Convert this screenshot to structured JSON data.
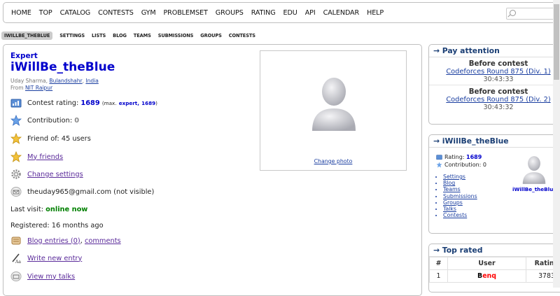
{
  "nav": {
    "items": [
      "HOME",
      "TOP",
      "CATALOG",
      "CONTESTS",
      "GYM",
      "PROBLEMSET",
      "GROUPS",
      "RATING",
      "EDU",
      "API",
      "CALENDAR",
      "HELP"
    ],
    "search_placeholder": ""
  },
  "subnav": {
    "active": "IWILLBE_THEBLUE",
    "items": [
      "SETTINGS",
      "LISTS",
      "BLOG",
      "TEAMS",
      "SUBMISSIONS",
      "GROUPS",
      "CONTESTS"
    ]
  },
  "profile": {
    "rank": "Expert",
    "handle": "iWillBe_theBlue",
    "name": "Uday Sharma,",
    "city": "Bulandshahr",
    "sep": ",",
    "country": "India",
    "from_label": "From",
    "org": "NIT Raipur",
    "rating_label": "Contest rating:",
    "rating": "1689",
    "max_open": "(max.",
    "max_rank": "expert,",
    "max_rating": "1689",
    "max_close": ")",
    "contribution_label": "Contribution:",
    "contribution": "0",
    "friend_of": "Friend of: 45 users",
    "my_friends": "My friends",
    "change_settings": "Change settings",
    "email": "theuday965@gmail.com (not visible)",
    "last_visit_label": "Last visit:",
    "last_visit": "online now",
    "registered": "Registered: 16 months ago",
    "blog_entries": "Blog entries (0)",
    "comma": ",",
    "comments": "comments",
    "write_entry": "Write new entry",
    "view_talks": "View my talks",
    "change_photo": "Change photo"
  },
  "attention": {
    "title": "→ Pay attention",
    "contests": [
      {
        "label": "Before contest",
        "name": "Codeforces Round 875 (Div. 1)",
        "countdown": "30:43:33"
      },
      {
        "label": "Before contest",
        "name": "Codeforces Round 875 (Div. 2)",
        "countdown": "30:43:32"
      }
    ]
  },
  "sidebar_profile": {
    "title": "→ iWillBe_theBlue",
    "rating_label": "Rating:",
    "rating": "1689",
    "contribution_label": "Contribution:",
    "contribution": "0",
    "links": [
      "Settings",
      "Blog",
      "Teams",
      "Submissions",
      "Groups",
      "Talks",
      "Contests"
    ],
    "avatar_name": "iWillBe_theBlue"
  },
  "top_rated": {
    "title": "→ Top rated",
    "headers": [
      "#",
      "User",
      "Rating"
    ],
    "rows": [
      {
        "rank": "1",
        "user_first": "B",
        "user_rest": "enq",
        "rating": "3783"
      }
    ]
  },
  "colors": {
    "expert": "#0000cc",
    "legendary_first": "#000000",
    "legendary_rest": "#ff0000",
    "online": "#008000"
  }
}
